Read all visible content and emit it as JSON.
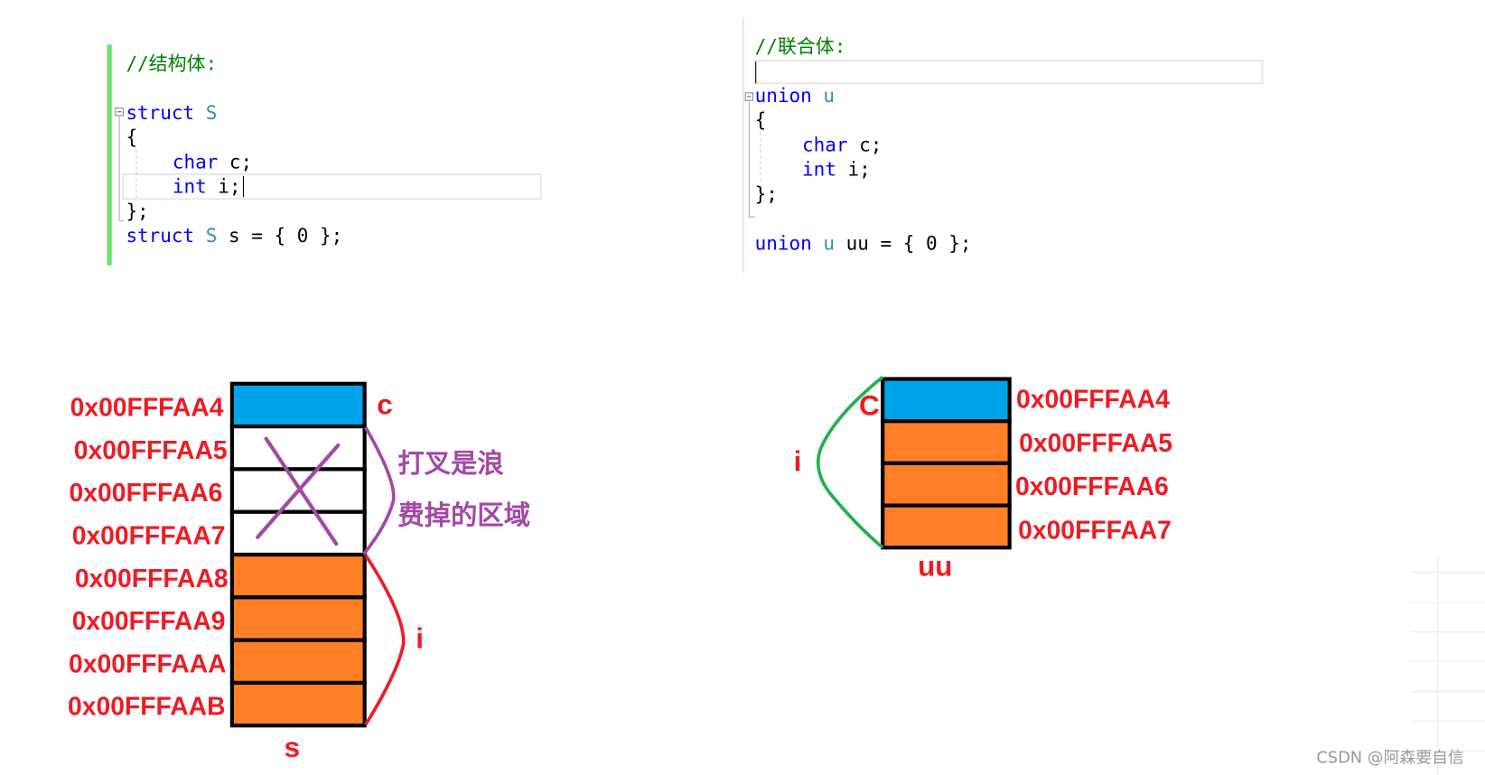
{
  "struct_code": {
    "comment": "//结构体:",
    "lines": [
      {
        "kw": "struct",
        "ty": "S",
        "rest": ""
      },
      {
        "kw": "",
        "ty": "",
        "rest": "{"
      },
      {
        "kw": "char",
        "ty": "",
        "rest": "c;"
      },
      {
        "kw": "int",
        "ty": "",
        "rest": "i;"
      },
      {
        "kw": "",
        "ty": "",
        "rest": "};"
      },
      {
        "kw": "struct",
        "ty": "S",
        "rest": "s = { 0 };"
      }
    ]
  },
  "union_code": {
    "comment": "//联合体:",
    "lines": [
      {
        "kw": "union",
        "ty": "u",
        "rest": ""
      },
      {
        "kw": "",
        "ty": "",
        "rest": "{"
      },
      {
        "kw": "char",
        "ty": "",
        "rest": "c;"
      },
      {
        "kw": "int",
        "ty": "",
        "rest": "i;"
      },
      {
        "kw": "",
        "ty": "",
        "rest": "};"
      },
      {
        "kw": "union",
        "ty": "u",
        "rest": "uu = { 0 };"
      }
    ]
  },
  "struct_diagram": {
    "addresses": [
      "0x00FFFAA4",
      "0x00FFFAA5",
      "0x00FFFAA6",
      "0x00FFFAA7",
      "0x00FFFAA8",
      "0x00FFFAA9",
      "0x00FFFAAA",
      "0x00FFFAAB"
    ],
    "cell_roles": [
      "c",
      "waste",
      "waste",
      "waste",
      "i",
      "i",
      "i",
      "i"
    ],
    "label_c": "c",
    "label_i": "i",
    "name": "s",
    "note_line1": "打叉是浪",
    "note_line2": "费掉的区域"
  },
  "union_diagram": {
    "addresses": [
      "0x00FFFAA4",
      "0x00FFFAA5",
      "0x00FFFAA6",
      "0x00FFFAA7"
    ],
    "cell_roles": [
      "c",
      "i",
      "i",
      "i"
    ],
    "label_c": "C",
    "label_i": "i",
    "name": "uu"
  },
  "colors": {
    "char_cell": "#00a2e8",
    "int_cell": "#ff7f27",
    "waste_cell": "#ffffff",
    "address_text": "#ed1c24",
    "note_text": "#a349a4",
    "union_brace": "#22b14c",
    "struct_i_brace": "#ed1c24",
    "keyword": "#0000ff",
    "type_name": "#2b91af",
    "comment": "#008000"
  },
  "watermark": "CSDN @阿森要自信"
}
